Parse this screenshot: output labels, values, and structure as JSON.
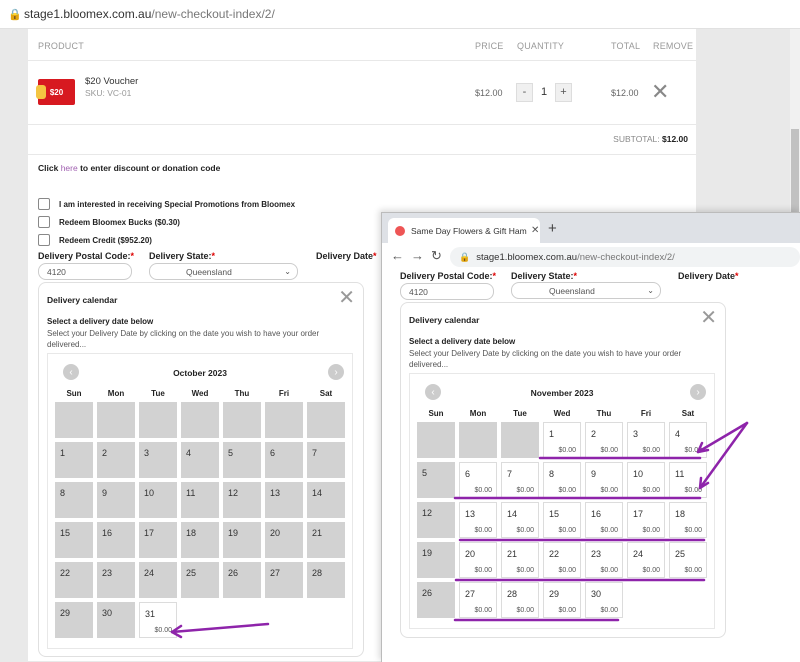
{
  "browser": {
    "url_host": "stage1.bloomex.com.au",
    "url_path": "/new-checkout-index/2/"
  },
  "cart": {
    "headers": {
      "product": "PRODUCT",
      "price": "PRICE",
      "quantity": "QUANTITY",
      "total": "TOTAL",
      "remove": "REMOVE"
    },
    "item": {
      "image_text": "$20",
      "name": "$20 Voucher",
      "sku": "SKU: VC-01",
      "price": "$12.00",
      "qty": "1",
      "minus": "-",
      "plus": "+",
      "total": "$12.00",
      "remove": "✕"
    },
    "subtotal_label": "SUBTOTAL:",
    "subtotal_value": "$12.00"
  },
  "discount": {
    "prefix": "Click ",
    "link": "here",
    "suffix": " to enter discount or donation code"
  },
  "options": [
    "I am interested in receiving Special Promotions from Bloomex",
    "Redeem Bloomex Bucks ($0.30)",
    "Redeem Credit ($952.20)"
  ],
  "delivery_form": {
    "postal_label": "Delivery Postal Code:",
    "postal_value": "4120",
    "state_label": "Delivery State:",
    "state_value": "Queensland",
    "date_label": "Delivery Date",
    "req": "*",
    "chevron": "⌄"
  },
  "calendar": {
    "title": "Delivery calendar",
    "select_heading": "Select a delivery date below",
    "select_desc": "Select your Delivery Date by clicking on the date you wish to have your order delivered...",
    "close": "✕",
    "days": [
      "Sun",
      "Mon",
      "Tue",
      "Wed",
      "Thu",
      "Fri",
      "Sat"
    ],
    "prev": "‹",
    "next": "›",
    "left_month": "October 2023",
    "right_month": "November 2023"
  },
  "overlay_browser": {
    "tab_title": "Same Day Flowers & Gift Hampers",
    "tab_close": "✕",
    "new_tab": "+",
    "back": "←",
    "forward": "→",
    "reload": "↻",
    "url_host": "stage1.bloomex.com.au",
    "url_path": "/new-checkout-index/2/"
  },
  "annotation_color": "#8e24aa",
  "price_label": "$0.00"
}
